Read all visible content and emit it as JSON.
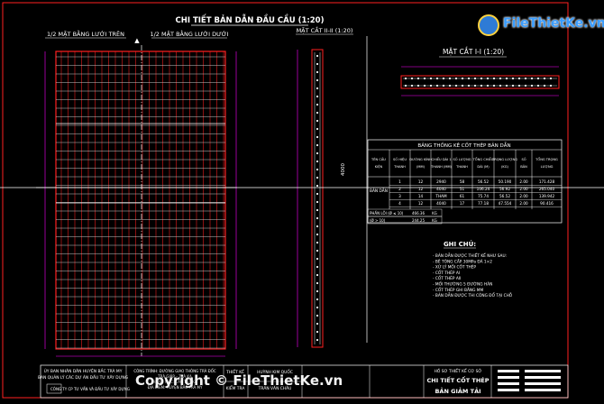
{
  "drawing": {
    "main_title": "CHI TIẾT BẢN DẪN ĐẦU CẦU (1:20)",
    "plan_left_label": "1/2 MẶT BẰNG LƯỚI TRÊN",
    "plan_right_label": "1/2 MẶT BẰNG LƯỚI DƯỚI",
    "section_ii_label": "MẶT CẮT II-II (1:20)",
    "section_i_label": "MẶT CẮT I-I (1:20)",
    "vertical_dim": "4000",
    "colors": {
      "background": "#000000",
      "rebar": "#ff0000",
      "grid": "#c8c8c8",
      "frame": "#ff2020",
      "text": "#ffffff",
      "dim": "#ff00ff"
    }
  },
  "table": {
    "title": "BẢNG THỐNG KÊ CỐT THÉP BẢN DẪN",
    "headers": [
      "TÊN CẤU KIỆN",
      "SỐ HIỆU THANH",
      "ĐƯỜNG KÍNH (MM)",
      "CHIỀU DÀI 1 THANH (MM)",
      "SỐ LƯỢNG THANH",
      "TỔNG CHIỀU DÀI (M)",
      "TRỌNG LƯỢNG (KG)",
      "SỐ BẢN",
      "TỔNG TRỌNG LƯỢNG"
    ],
    "member": "BẢN DẪN",
    "rows": [
      [
        "1",
        "12",
        "2940",
        "58",
        "56.52",
        "50.190",
        "2.00",
        "171.428"
      ],
      [
        "2",
        "12",
        "4040",
        "51",
        "106.24",
        "56.92",
        "2.00",
        "265.040"
      ],
      [
        "3",
        "14",
        "THAM",
        "61",
        "75.74",
        "56.52",
        "2.00",
        "139.942"
      ],
      [
        "4",
        "12",
        "4040",
        "17",
        "77.18",
        "47.554",
        "2.00",
        "90.416"
      ]
    ],
    "totals": [
      {
        "label": "PHẦN LÕI (Ø ≤ 10)",
        "value": "466.36",
        "unit": "KG"
      },
      {
        "label": "(Ø > 10)",
        "value": "244.25",
        "unit": "KG"
      }
    ]
  },
  "notes": {
    "title": "GHI CHÚ:",
    "lines": [
      "- BẢN DẪN ĐƯỢC THIẾT KẾ NHƯ SAU:",
      "- BÊ TÔNG CẤP 30MPa ĐÁ 1×2",
      "- XỬ LÝ MỐI CỐT THÉP",
      "- CỐT THÉP AI",
      "- CỐT THÉP AII",
      "- MỐI THƯỜNG 5 ĐƯỜNG HÀN",
      "- CỐT THÉP GHI BẰNG MM",
      "- BẢN DẪN ĐƯỢC THI CÔNG ĐỔ TẠI CHỖ"
    ]
  },
  "title_block": {
    "client_lines": [
      "ỦY BAN NHÂN DÂN HUYỆN BẮC TRÀ MY",
      "BAN QUẢN LÝ CÁC DỰ ÁN ĐẦU TƯ XÂY DỰNG"
    ],
    "consultant": "CÔNG TY CP TƯ VẤN VÀ ĐẦU TƯ XÂY DỰNG",
    "project_lines": [
      "CÔNG TRÌNH: ĐƯỜNG GIAO THÔNG TRÀ ĐỐC",
      "TRÀ GIÁP – TRÀ KA",
      "HẠNG MỤC: CẦU TRÀ KA",
      "ĐỊA ĐIỂM: HUYỆN BẮC TRÀ MY"
    ],
    "role_labels": [
      "THIẾT KẾ",
      "KIỂM TRA"
    ],
    "names": [
      "HUỲNH KIM QUỐC",
      "TRẦN VĂN CHÂU"
    ],
    "drawing_no_label": "HỒ SƠ THIẾT KẾ CƠ SỞ",
    "sheet_title_line1": "CHI TIẾT CỐT THÉP",
    "sheet_title_line2": "BẢN GIẢM TẢI"
  },
  "watermark": {
    "brand": "FileThietKe.vn",
    "copyright": "Copyright © FileThietKe.vn"
  }
}
